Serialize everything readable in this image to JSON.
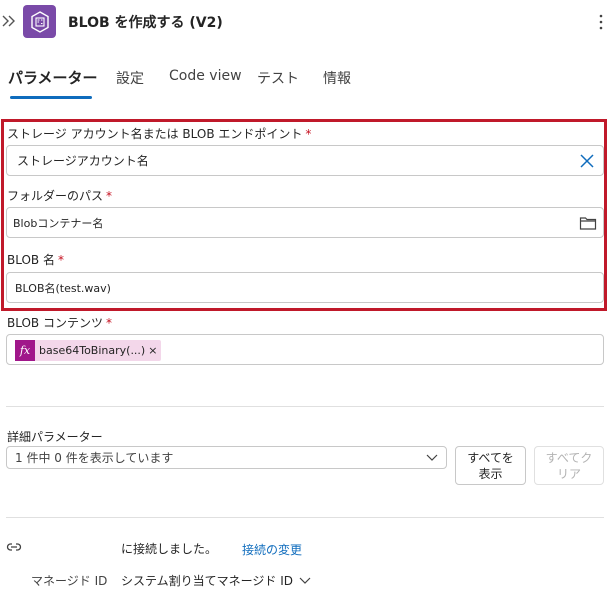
{
  "header": {
    "title": "BLOB を作成する (V2)",
    "icon": "blob-storage-icon",
    "brand_color": "#7a4aa8"
  },
  "tabs": [
    {
      "label": "パラメーター",
      "active": true
    },
    {
      "label": "設定"
    },
    {
      "label": "Code view"
    },
    {
      "label": "テスト"
    },
    {
      "label": "情報"
    }
  ],
  "required_marker": "*",
  "fields": {
    "storage_account": {
      "label": "ストレージ アカウント名または BLOB エンドポイント",
      "value": "ストレージアカウント名"
    },
    "folder_path": {
      "label": "フォルダーのパス",
      "value": "Blobコンテナー名"
    },
    "blob_name": {
      "label": "BLOB 名",
      "value": "BLOB名(test.wav)"
    },
    "blob_content": {
      "label": "BLOB コンテンツ",
      "token": "base64ToBinary(...)",
      "token_remove": "×",
      "token_fx": "fx"
    }
  },
  "advanced": {
    "label": "詳細パラメーター",
    "dropdown_value": "1 件中 0 件を表示しています",
    "show_all": [
      "すべてを",
      "表示"
    ],
    "clear_all": [
      "すべてク",
      "リア"
    ]
  },
  "connection": {
    "status": "に接続しました。",
    "change_link": "接続の変更",
    "managed_id_label": "マネージド ID",
    "managed_id_value": "システム割り当てマネージド ID"
  },
  "colors": {
    "accent": "#0f6cbd",
    "highlight": "#c0192a",
    "token_bg": "#f3d7ea",
    "token_fx": "#a0168a"
  }
}
